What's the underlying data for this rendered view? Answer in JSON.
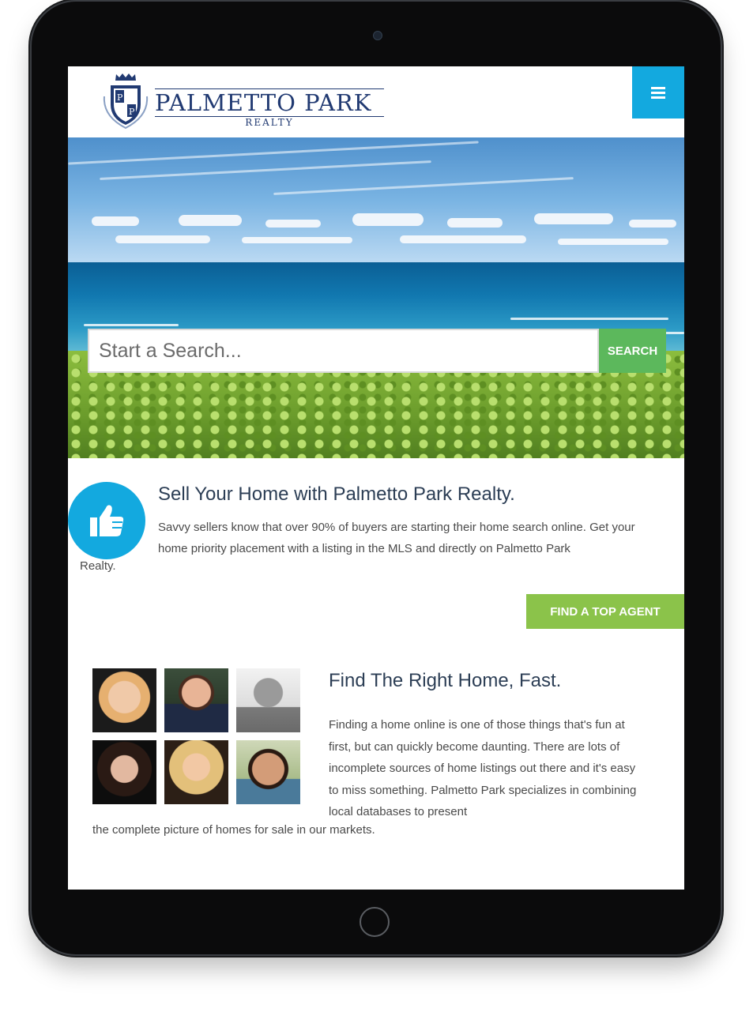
{
  "header": {
    "brand_name": "PALMETTO PARK",
    "brand_sub": "REALTY",
    "logo_letters": "P P",
    "menu_icon": "hamburger-icon"
  },
  "colors": {
    "accent_blue": "#13a9df",
    "search_green": "#5cb85c",
    "agent_green": "#8bc34a",
    "brand_navy": "#213a72"
  },
  "hero": {
    "search_placeholder": "Start a Search...",
    "search_button": "SEARCH"
  },
  "sell": {
    "icon": "thumbs-up-icon",
    "title": "Sell Your Home with Palmetto Park Realty.",
    "text": "Savvy sellers know that over 90% of buyers are starting their home search online. Get your home priority placement with a listing in the MLS and directly on Palmetto Park",
    "text_end": "Realty.",
    "button": "FIND A TOP AGENT"
  },
  "find": {
    "title": "Find The Right Home, Fast.",
    "text": "Finding a home online is one of those things that's fun at first, but can quickly become daunting. There are lots of incomplete sources of home listings out there and it's easy to miss something. Palmetto Park specializes in combining local databases to present",
    "text_end": "the complete picture of homes for sale in our markets.",
    "agent_photos": [
      "agent-photo-1",
      "agent-photo-2",
      "agent-photo-3",
      "agent-photo-4",
      "agent-photo-5",
      "agent-photo-6"
    ]
  }
}
